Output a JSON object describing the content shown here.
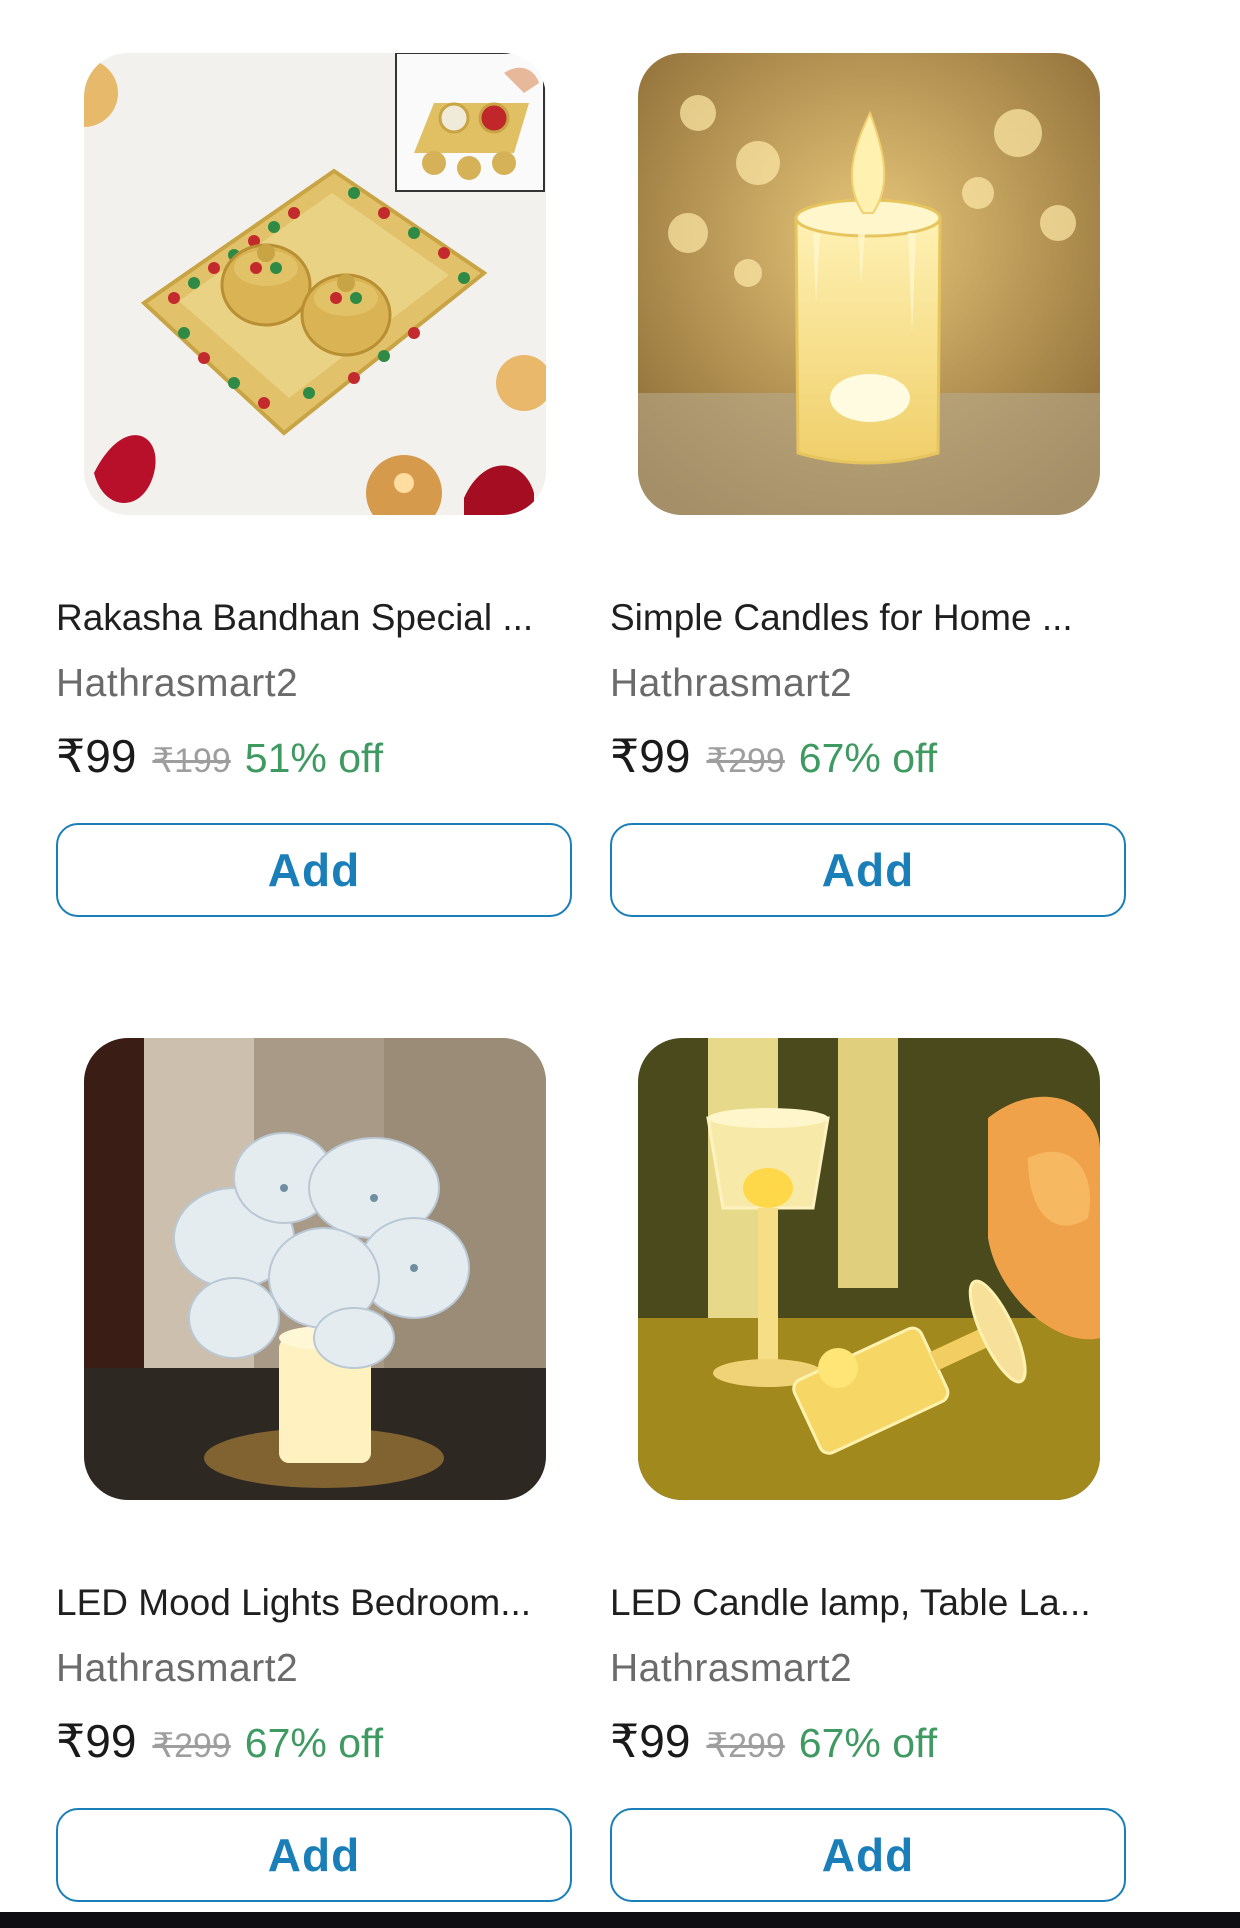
{
  "products": [
    {
      "title": "Rakasha Bandhan Special ...",
      "seller": "Hathrasmart2",
      "price": "₹99",
      "mrp": "₹199",
      "discount": "51% off",
      "add_label": "Add",
      "image_icon": "puja-thali-image"
    },
    {
      "title": "Simple Candles for Home ...",
      "seller": "Hathrasmart2",
      "price": "₹99",
      "mrp": "₹299",
      "discount": "67% off",
      "add_label": "Add",
      "image_icon": "led-candle-image"
    },
    {
      "title": "LED Mood Lights Bedroom...",
      "seller": "Hathrasmart2",
      "price": "₹99",
      "mrp": "₹299",
      "discount": "67% off",
      "add_label": "Add",
      "image_icon": "flower-mood-light-image"
    },
    {
      "title": "LED Candle lamp, Table La...",
      "seller": "Hathrasmart2",
      "price": "₹99",
      "mrp": "₹299",
      "discount": "67% off",
      "add_label": "Add",
      "image_icon": "crystal-lamp-image"
    }
  ],
  "colors": {
    "accent": "#1a7fb9",
    "discount": "#3f9a62",
    "mrp": "#9e9e9e"
  }
}
